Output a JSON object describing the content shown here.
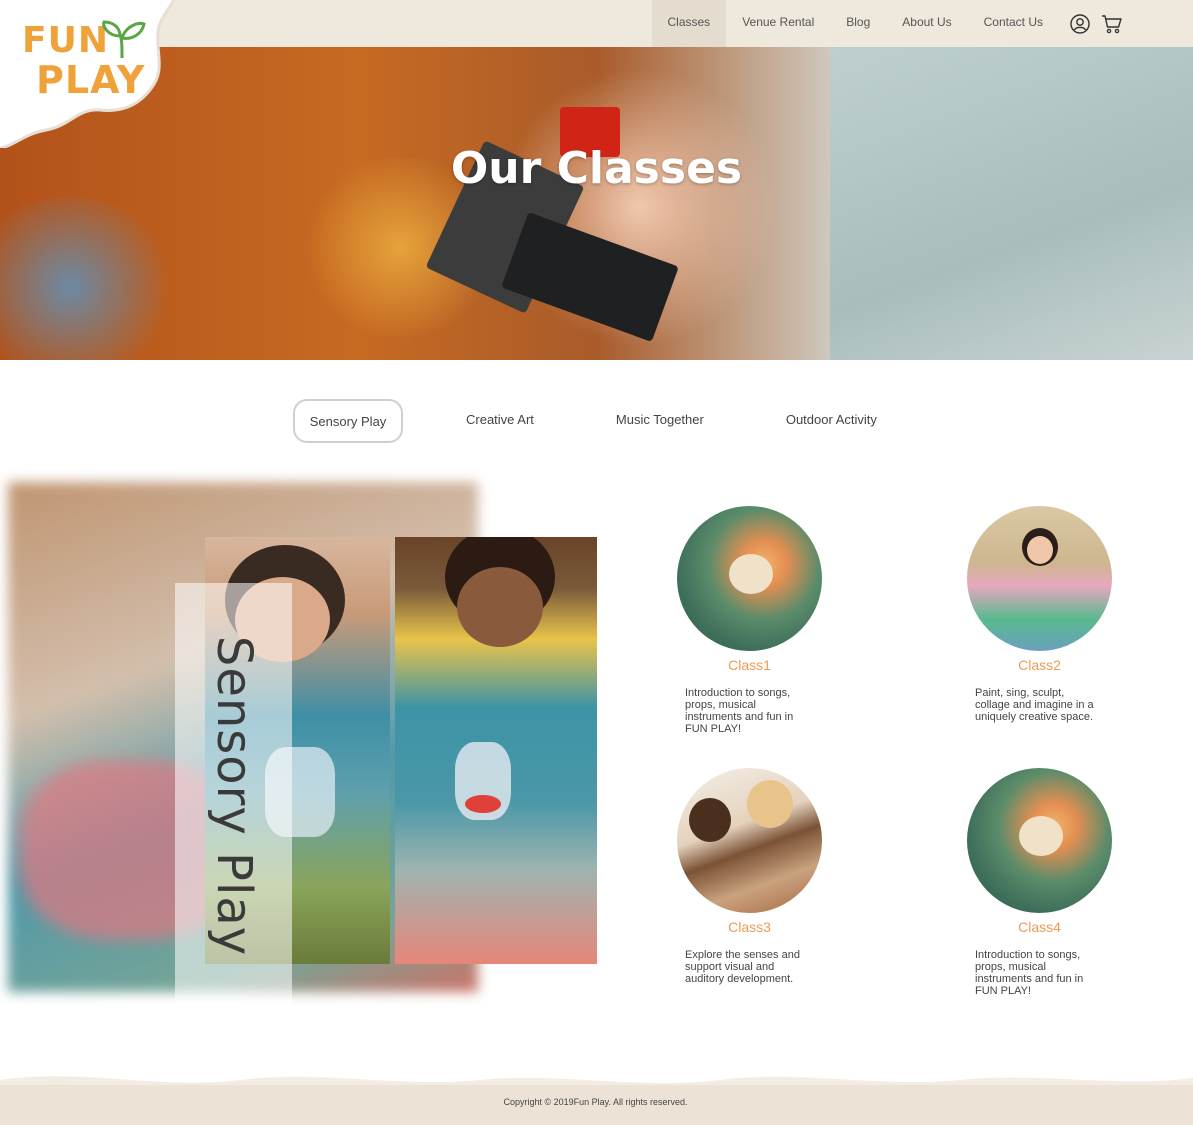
{
  "logo": {
    "line1": "FUN",
    "line2": "PLAY"
  },
  "nav": {
    "items": [
      {
        "label": "Classes",
        "active": true
      },
      {
        "label": "Venue Rental",
        "active": false
      },
      {
        "label": "Blog",
        "active": false
      },
      {
        "label": "About Us",
        "active": false
      },
      {
        "label": "Contact Us",
        "active": false
      }
    ],
    "icons": [
      "user-icon",
      "cart-icon"
    ]
  },
  "hero": {
    "title": "Our Classes"
  },
  "tabs": [
    {
      "label": "Sensory Play",
      "active": true
    },
    {
      "label": "Creative Art",
      "active": false
    },
    {
      "label": "Music Together",
      "active": false
    },
    {
      "label": "Outdoor Activity",
      "active": false
    }
  ],
  "feature": {
    "label": "Sensory Play"
  },
  "classes": [
    {
      "name": "Class1",
      "description": "Introduction to songs, props, musical instruments and fun in FUN PLAY!"
    },
    {
      "name": "Class2",
      "description": "Paint, sing, sculpt, collage and imagine in a uniquely creative space."
    },
    {
      "name": "Class3",
      "description": "Explore the senses and support visual and auditory development."
    },
    {
      "name": "Class4",
      "description": "Introduction to songs, props, musical instruments and fun in FUN PLAY!"
    }
  ],
  "footer": {
    "copyright": "Copyright © 2019Fun Play. All rights reserved."
  },
  "colors": {
    "brand_orange": "#f0a23a",
    "class_name": "#ef9a53",
    "topbar": "#efe8dc",
    "footer": "#ece3d6",
    "sprout_green": "#5aa544"
  }
}
